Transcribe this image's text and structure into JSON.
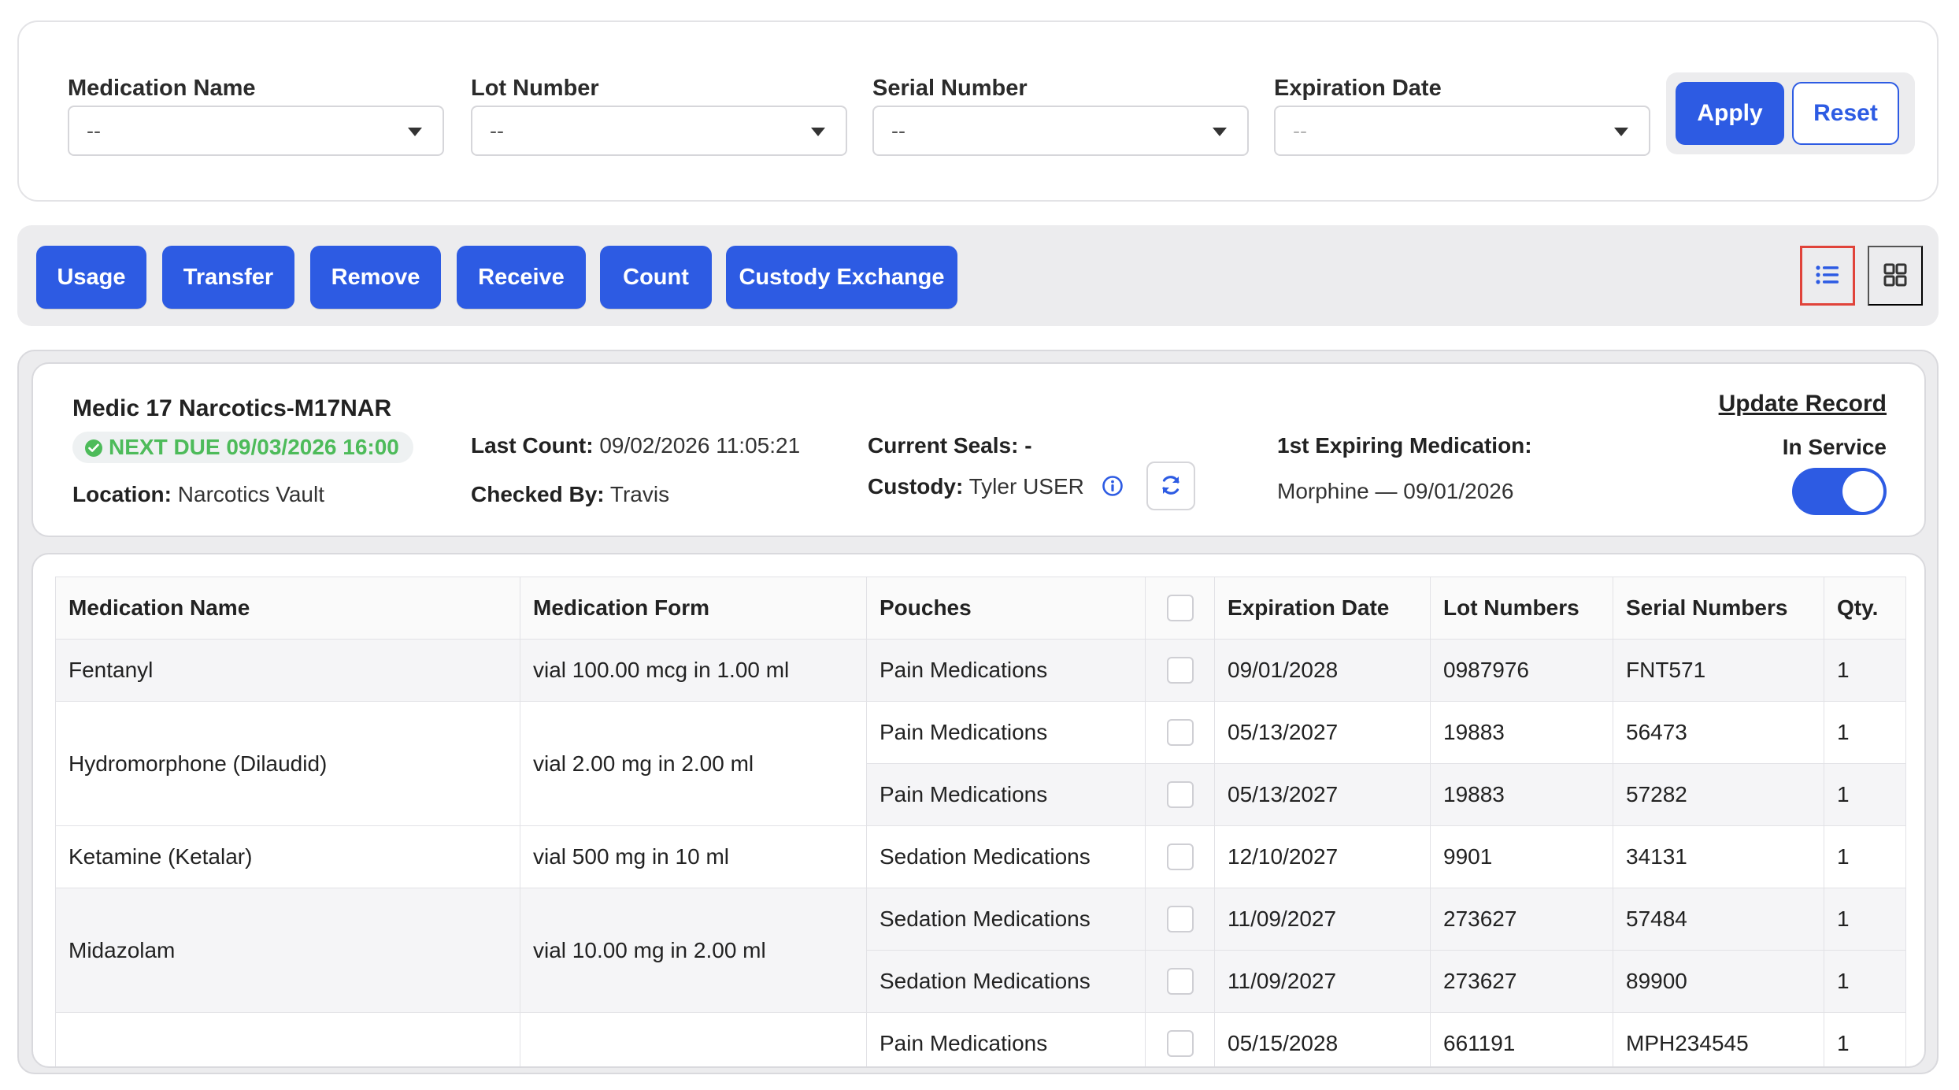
{
  "filters": {
    "fields": [
      {
        "label": "Medication Name",
        "value": "--",
        "disabled": false
      },
      {
        "label": "Lot Number",
        "value": "--",
        "disabled": false
      },
      {
        "label": "Serial Number",
        "value": "--",
        "disabled": false
      },
      {
        "label": "Expiration Date",
        "value": "--",
        "disabled": true
      }
    ],
    "apply_label": "Apply",
    "reset_label": "Reset"
  },
  "actions": [
    "Usage",
    "Transfer",
    "Remove",
    "Receive",
    "Count",
    "Custody Exchange"
  ],
  "view_toggle": {
    "list_icon": "list-icon",
    "grid_icon": "grid-icon",
    "active": "list"
  },
  "unit": {
    "name": "Medic 17 Narcotics-M17NAR",
    "next_due": "NEXT DUE 09/03/2026 16:00",
    "location_label": "Location:",
    "location_value": "Narcotics Vault",
    "last_count_label": "Last Count:",
    "last_count_value": "09/02/2026 11:05:21",
    "checked_by_label": "Checked By:",
    "checked_by_value": "Travis",
    "current_seals_label": "Current Seals:",
    "current_seals_value": "-",
    "custody_label": "Custody:",
    "custody_value": "Tyler USER",
    "first_expiring_label": "1st Expiring Medication:",
    "first_expiring_value": "Morphine — 09/01/2026",
    "update_record_label": "Update Record",
    "in_service_label": "In Service",
    "in_service": true
  },
  "colors": {
    "accent": "#2d5be3",
    "due_green": "#4dbb5a",
    "highlight_border": "#e0433a"
  },
  "table": {
    "headers": [
      "Medication Name",
      "Medication Form",
      "Pouches",
      "",
      "Expiration Date",
      "Lot Numbers",
      "Serial Numbers",
      "Qty."
    ],
    "groups": [
      {
        "name": "Fentanyl",
        "form": "vial 100.00 mcg in 1.00 ml",
        "rows": [
          {
            "pouch": "Pain Medications",
            "exp": "09/01/2028",
            "lot": "0987976",
            "serial": "FNT571",
            "qty": "1"
          }
        ]
      },
      {
        "name": "Hydromorphone (Dilaudid)",
        "form": "vial 2.00 mg in 2.00 ml",
        "rows": [
          {
            "pouch": "Pain Medications",
            "exp": "05/13/2027",
            "lot": "19883",
            "serial": "56473",
            "qty": "1"
          },
          {
            "pouch": "Pain Medications",
            "exp": "05/13/2027",
            "lot": "19883",
            "serial": "57282",
            "qty": "1"
          }
        ]
      },
      {
        "name": "Ketamine (Ketalar)",
        "form": "vial 500 mg in 10 ml",
        "rows": [
          {
            "pouch": "Sedation Medications",
            "exp": "12/10/2027",
            "lot": "9901",
            "serial": "34131",
            "qty": "1"
          }
        ]
      },
      {
        "name": "Midazolam",
        "form": "vial 10.00 mg in 2.00 ml",
        "rows": [
          {
            "pouch": "Sedation Medications",
            "exp": "11/09/2027",
            "lot": "273627",
            "serial": "57484",
            "qty": "1"
          },
          {
            "pouch": "Sedation Medications",
            "exp": "11/09/2027",
            "lot": "273627",
            "serial": "89900",
            "qty": "1"
          }
        ]
      },
      {
        "name": "",
        "form": "",
        "rows": [
          {
            "pouch": "Pain Medications",
            "exp": "05/15/2028",
            "lot": "661191",
            "serial": "MPH234545",
            "qty": "1"
          }
        ]
      }
    ]
  }
}
